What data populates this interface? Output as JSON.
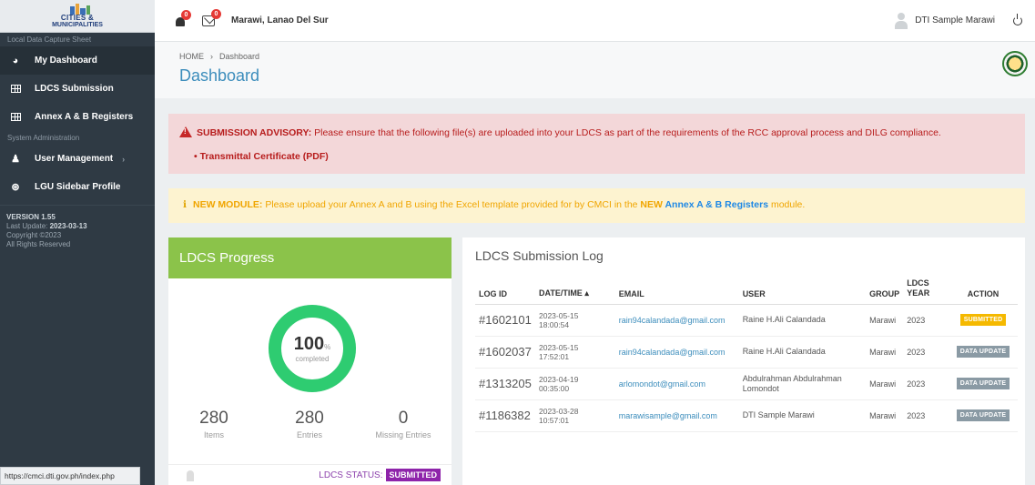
{
  "logo": {
    "line1": "CITIES &",
    "line2": "MUNICIPALITIES"
  },
  "sidebar": {
    "section1": "Local Data Capture Sheet",
    "items": [
      {
        "label": "My Dashboard",
        "icon": "dashboard-icon"
      },
      {
        "label": "LDCS Submission",
        "icon": "table-icon"
      },
      {
        "label": "Annex A & B Registers",
        "icon": "table-icon"
      }
    ],
    "section2": "System Administration",
    "admin_items": [
      {
        "label": "User Management",
        "icon": "user-icon"
      },
      {
        "label": "LGU Sidebar Profile",
        "icon": "profile-icon"
      }
    ],
    "version": "VERSION 1.55",
    "last_update_label": "Last Update:",
    "last_update": "2023-03-13",
    "copyright": "Copyright ©2023",
    "rights": "All Rights Reserved"
  },
  "status_url": "https://cmci.dti.gov.ph/index.php",
  "topbar": {
    "bell_count": "0",
    "mail_count": "0",
    "location": "Marawi, Lanao Del Sur",
    "user": "DTI Sample Marawi"
  },
  "header": {
    "home": "HOME",
    "sep": "›",
    "crumb": "Dashboard",
    "title": "Dashboard"
  },
  "advisory": {
    "label": "SUBMISSION ADVISORY:",
    "text": " Please ensure that the following file(s) are uploaded into your LDCS as part of the requirements of the RCC approval process and DILG compliance.",
    "item": "• Transmittal Certificate (PDF)"
  },
  "module_notice": {
    "icon": "i",
    "label": "NEW MODULE:",
    "text1": " Please upload your Annex A and B using the Excel template provided for by CMCI in the ",
    "new": "NEW",
    "link": " Annex A & B Registers",
    "text2": " module."
  },
  "progress": {
    "title": "LDCS Progress",
    "percent": 100,
    "percent_label": "100",
    "percent_unit": "%",
    "completed_label": "completed",
    "stats": [
      {
        "value": "280",
        "label": "Items"
      },
      {
        "value": "280",
        "label": "Entries"
      },
      {
        "value": "0",
        "label": "Missing Entries"
      }
    ],
    "status_label": "LDCS STATUS:",
    "status_value": "SUBMITTED",
    "ring_color": "#2ecc71"
  },
  "log": {
    "title": "LDCS Submission Log",
    "headers": [
      "LOG ID",
      "DATE/TIME ▴",
      "EMAIL",
      "USER",
      "GROUP",
      "LDCS YEAR",
      "ACTION"
    ],
    "rows": [
      {
        "id": "#1602101",
        "date": "2023-05-15",
        "time": "18:00:54",
        "email": "rain94calandada@gmail.com",
        "user": "Raine H.Ali Calandada",
        "group": "Marawi",
        "year": "2023",
        "action": "SUBMITTED"
      },
      {
        "id": "#1602037",
        "date": "2023-05-15",
        "time": "17:52:01",
        "email": "rain94calandada@gmail.com",
        "user": "Raine H.Ali Calandada",
        "group": "Marawi",
        "year": "2023",
        "action": "DATA UPDATE"
      },
      {
        "id": "#1313205",
        "date": "2023-04-19",
        "time": "00:35:00",
        "email": "arlomondot@gmail.com",
        "user": "Abdulrahman Abdulrahman Lomondot",
        "group": "Marawi",
        "year": "2023",
        "action": "DATA UPDATE"
      },
      {
        "id": "#1186382",
        "date": "2023-03-28",
        "time": "10:57:01",
        "email": "marawisample@gmail.com",
        "user": "DTI Sample Marawi",
        "group": "Marawi",
        "year": "2023",
        "action": "DATA UPDATE"
      }
    ]
  }
}
